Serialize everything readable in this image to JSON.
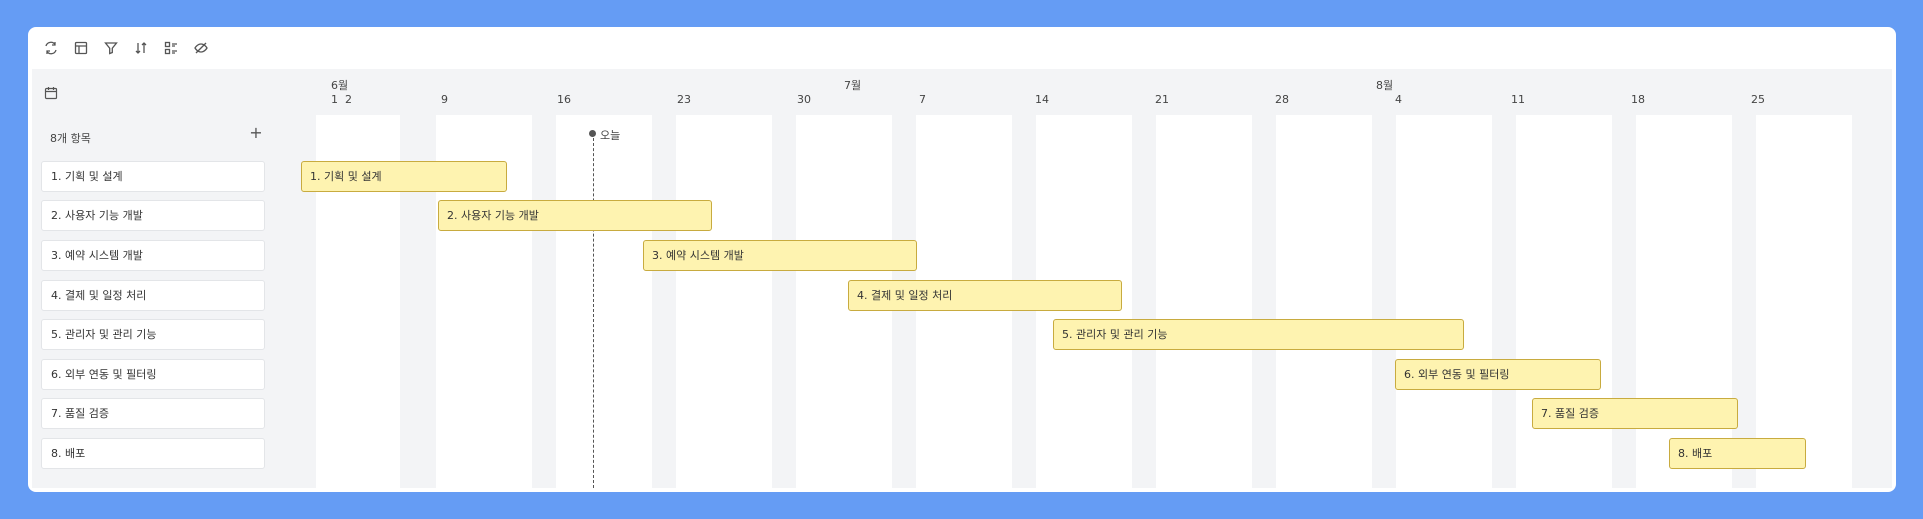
{
  "toolbar": {
    "icons": [
      "refresh-icon",
      "table-icon",
      "filter-icon",
      "sort-icon",
      "group-icon",
      "hide-icon"
    ]
  },
  "timeline": {
    "months": [
      "6월",
      "7월",
      "8월"
    ],
    "days": [
      "1",
      "2",
      "9",
      "16",
      "23",
      "30",
      "7",
      "14",
      "21",
      "28",
      "4",
      "11",
      "18",
      "25"
    ],
    "today_label": "오늘"
  },
  "list": {
    "count_label": "8개 항목",
    "add_label": "+",
    "items": [
      "1. 기획 및 설계",
      "2. 사용자 기능 개발",
      "3. 예약 시스템 개발",
      "4. 결제 및 일정 처리",
      "5. 관리자 및 관리 기능",
      "6. 외부 연동 및 필터링",
      "7. 품질 검증",
      "8. 배포"
    ]
  },
  "colors": {
    "background": "#659cf4",
    "bar_fill": "#fef3b0",
    "bar_border": "#c8ab3f",
    "weekend_bg": "#f3f4f6"
  }
}
